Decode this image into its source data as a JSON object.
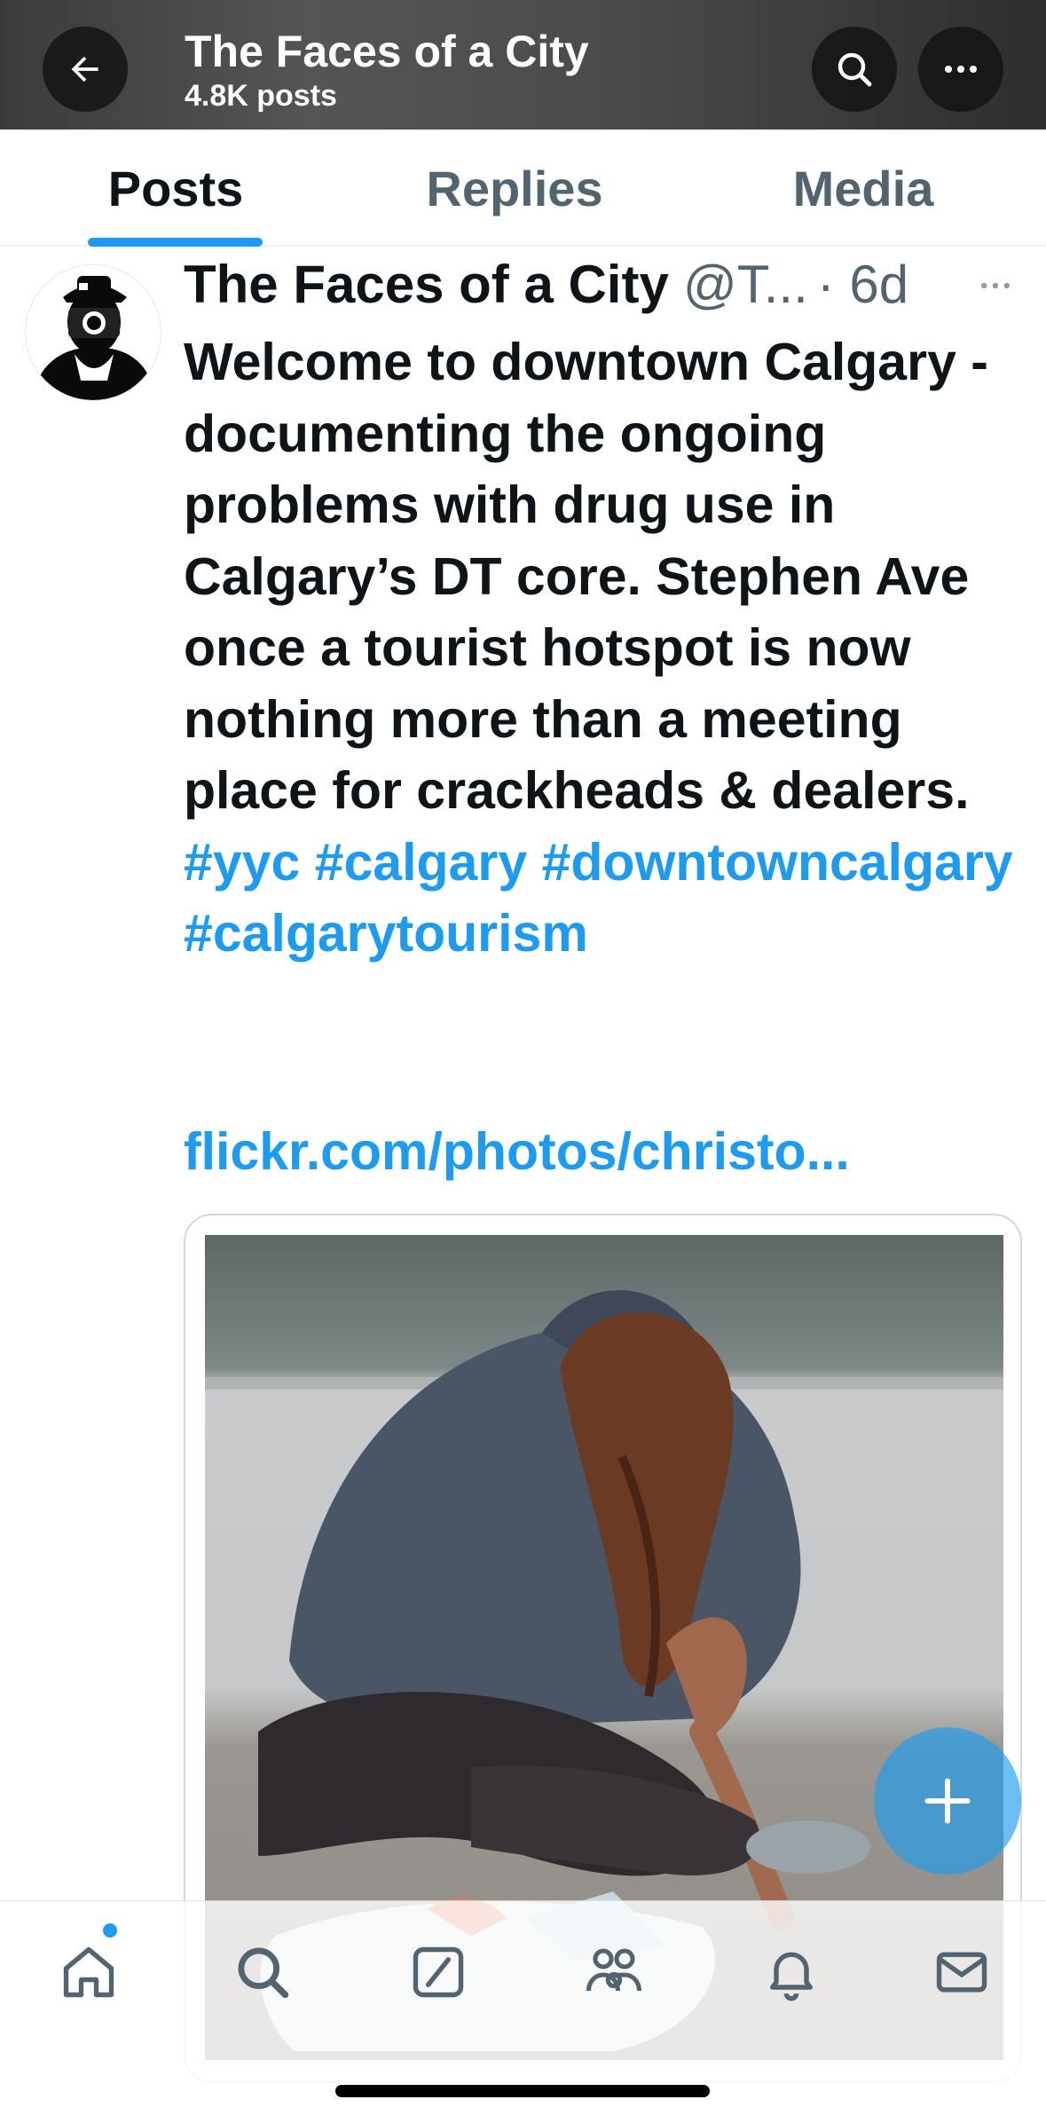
{
  "header": {
    "title": "The Faces of a City",
    "subtitle": "4.8K posts",
    "back_icon": "arrow-left-icon",
    "search_icon": "search-icon",
    "more_icon": "more-horizontal-icon"
  },
  "tabs": [
    {
      "label": "Posts",
      "active": true
    },
    {
      "label": "Replies",
      "active": false
    },
    {
      "label": "Media",
      "active": false
    }
  ],
  "post": {
    "author_name": "The Faces of a City",
    "author_handle": "@T...",
    "time": "· 6d",
    "text_main": "Welcome to downtown Calgary - documenting the ongoing problems with drug use in Calgary’s DT core. Stephen Ave once a tourist hotspot is now nothing more than a meeting place for crackheads & dealers. ",
    "hashtags": [
      "#yyc",
      "#calgary",
      "#downtowncalgary",
      "#calgarytourism"
    ],
    "link": "flickr.com/photos/christo..."
  },
  "fab": {
    "icon": "plus-icon"
  },
  "bottom_nav": [
    {
      "name": "home",
      "icon": "home-icon"
    },
    {
      "name": "search",
      "icon": "search-icon"
    },
    {
      "name": "grok",
      "icon": "grok-icon"
    },
    {
      "name": "communities",
      "icon": "communities-icon"
    },
    {
      "name": "notifications",
      "icon": "bell-icon"
    },
    {
      "name": "messages",
      "icon": "mail-icon"
    }
  ],
  "colors": {
    "accent": "#1d9bf0",
    "text_primary": "#0f1419",
    "text_secondary": "#536471"
  }
}
